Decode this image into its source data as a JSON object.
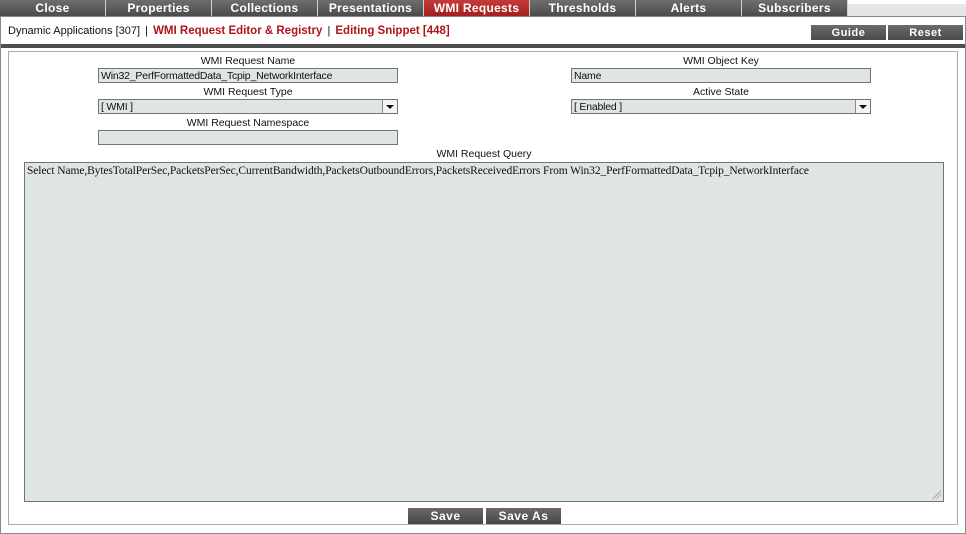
{
  "tabs": [
    {
      "label": "Close",
      "active": false
    },
    {
      "label": "Properties",
      "active": false
    },
    {
      "label": "Collections",
      "active": false
    },
    {
      "label": "Presentations",
      "active": false
    },
    {
      "label": "WMI Requests",
      "active": true
    },
    {
      "label": "Thresholds",
      "active": false
    },
    {
      "label": "Alerts",
      "active": false
    },
    {
      "label": "Subscribers",
      "active": false
    }
  ],
  "header": {
    "breadcrumb_root": "Dynamic Applications [307]",
    "separator": "|",
    "editor_title": "WMI Request Editor & Registry",
    "editing_snippet": "Editing Snippet [448]",
    "guide_label": "Guide",
    "reset_label": "Reset"
  },
  "form": {
    "request_name_label": "WMI Request Name",
    "request_name_value": "Win32_PerfFormattedData_Tcpip_NetworkInterface",
    "object_key_label": "WMI Object Key",
    "object_key_value": "Name",
    "request_type_label": "WMI Request Type",
    "request_type_value": "[ WMI ]",
    "active_state_label": "Active State",
    "active_state_value": "[ Enabled ]",
    "namespace_label": "WMI Request Namespace",
    "namespace_value": "",
    "query_label": "WMI Request Query",
    "query_value": "Select Name,BytesTotalPerSec,PacketsPerSec,CurrentBandwidth,PacketsOutboundErrors,PacketsReceivedErrors From Win32_PerfFormattedData_Tcpip_NetworkInterface"
  },
  "actions": {
    "save_label": "Save",
    "save_as_label": "Save As"
  },
  "colors": {
    "active_tab": "#b3262a",
    "tab": "#595959",
    "title_red": "#b0141b",
    "field_bg": "#dfe4e4"
  }
}
